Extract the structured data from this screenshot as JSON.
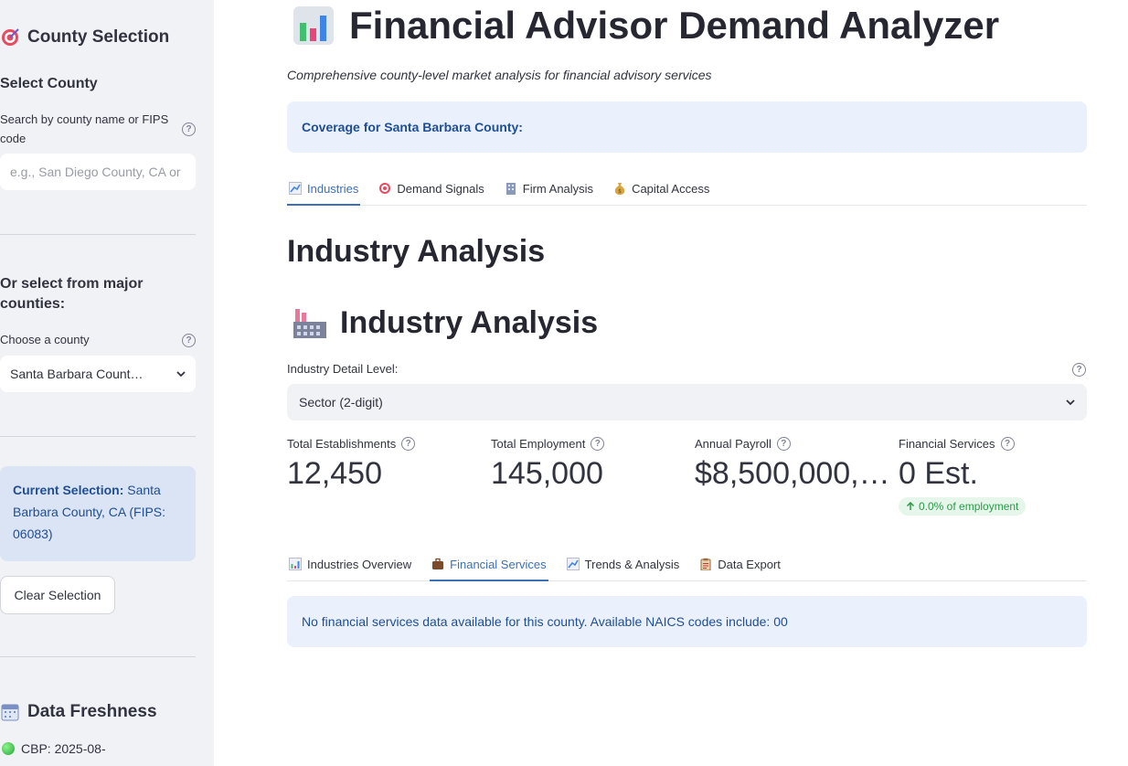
{
  "sidebar": {
    "county_selection_heading": "County Selection",
    "select_county_heading": "Select County",
    "search_label": "Search by county name or FIPS code",
    "search_placeholder": "e.g., San Diego County, CA or",
    "major_heading": "Or select from major counties:",
    "choose_label": "Choose a county",
    "choose_value": "Santa Barbara Count…",
    "current_selection_label": "Current Selection:",
    "current_selection_value": "Santa Barbara County, CA (FIPS: 06083)",
    "clear_button": "Clear Selection",
    "data_freshness_heading": "Data Freshness",
    "freshness_item": "CBP: 2025-08-"
  },
  "header": {
    "title": "Financial Advisor Demand Analyzer",
    "subtitle": "Comprehensive county-level market analysis for financial advisory services",
    "coverage": "Coverage for Santa Barbara County:"
  },
  "main_tabs": [
    {
      "label": "Industries",
      "icon": "chart-increasing-icon",
      "active": true
    },
    {
      "label": "Demand Signals",
      "icon": "target-icon",
      "active": false
    },
    {
      "label": "Firm Analysis",
      "icon": "office-building-icon",
      "active": false
    },
    {
      "label": "Capital Access",
      "icon": "money-bag-icon",
      "active": false
    }
  ],
  "section": {
    "heading": "Industry Analysis",
    "subheading": "Industry Analysis",
    "detail_label": "Industry Detail Level:",
    "detail_value": "Sector (2-digit)"
  },
  "metrics": [
    {
      "label": "Total Establishments",
      "value": "12,450"
    },
    {
      "label": "Total Employment",
      "value": "145,000"
    },
    {
      "label": "Annual Payroll",
      "value": "$8,500,000,…"
    },
    {
      "label": "Financial Services",
      "value": "0 Est.",
      "delta": "0.0% of employment"
    }
  ],
  "sub_tabs": [
    {
      "label": "Industries Overview",
      "icon": "bar-chart-icon",
      "active": false
    },
    {
      "label": "Financial Services",
      "icon": "briefcase-icon",
      "active": true
    },
    {
      "label": "Trends & Analysis",
      "icon": "chart-increasing-icon",
      "active": false
    },
    {
      "label": "Data Export",
      "icon": "clipboard-icon",
      "active": false
    }
  ],
  "notice": "No financial services data available for this county. Available NAICS codes include: 00",
  "colors": {
    "accent": "#3d6fb6",
    "info_bg": "#eaf1fc",
    "sidebar_bg": "#f0f2f6",
    "success": "#2b9a4a"
  }
}
